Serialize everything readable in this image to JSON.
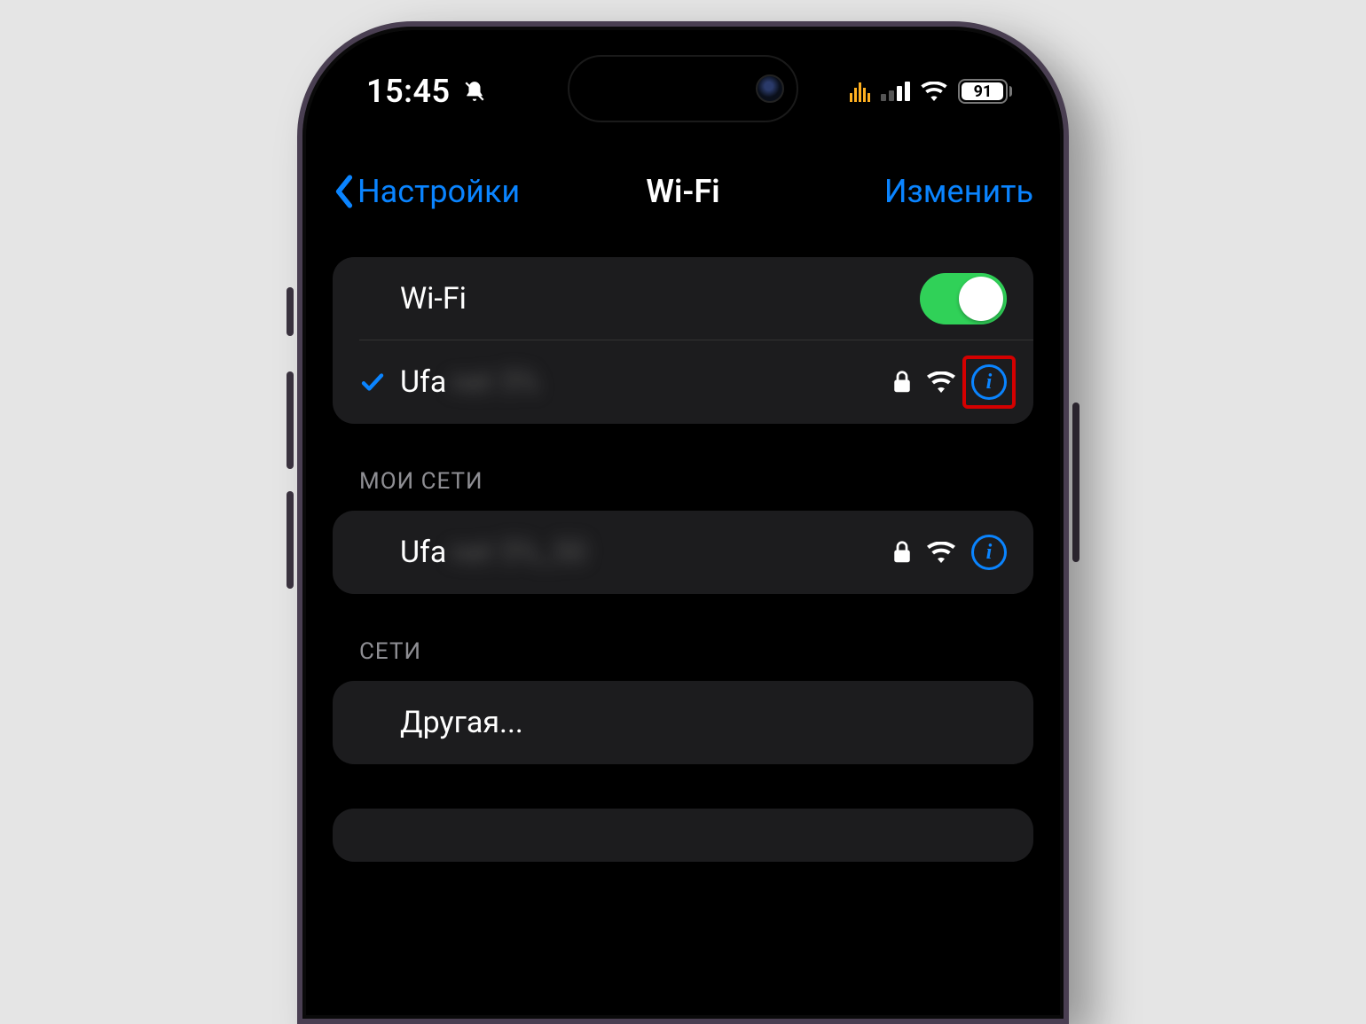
{
  "status": {
    "time": "15:45",
    "battery": "91"
  },
  "nav": {
    "back": "Настройки",
    "title": "Wi-Fi",
    "edit": "Изменить"
  },
  "wifi": {
    "toggle_label": "Wi-Fi",
    "connected": {
      "name_visible": "Ufa",
      "name_blurred": "net 5% "
    }
  },
  "sections": {
    "my_networks": {
      "header": "МОИ СЕТИ",
      "items": [
        {
          "name_visible": "Ufa",
          "name_blurred": "net 5%_50 "
        }
      ]
    },
    "other_networks": {
      "header": "СЕТИ",
      "other_label": "Другая..."
    }
  }
}
